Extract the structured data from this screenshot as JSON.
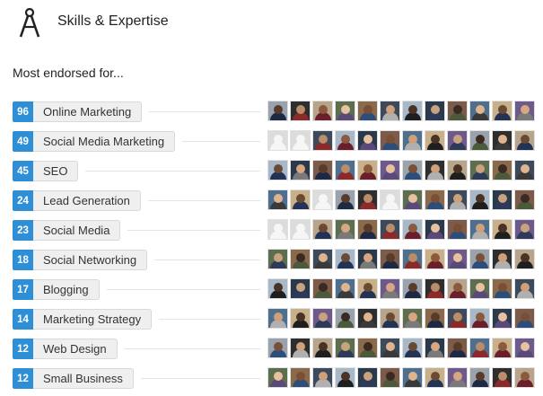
{
  "header": {
    "title": "Skills & Expertise",
    "icon": "compass-icon"
  },
  "subhead": "Most endorsed for...",
  "skills": [
    {
      "count": "96",
      "name": "Online Marketing"
    },
    {
      "count": "49",
      "name": "Social Media Marketing"
    },
    {
      "count": "45",
      "name": "SEO"
    },
    {
      "count": "24",
      "name": "Lead Generation"
    },
    {
      "count": "23",
      "name": "Social Media"
    },
    {
      "count": "18",
      "name": "Social Networking"
    },
    {
      "count": "17",
      "name": "Blogging"
    },
    {
      "count": "14",
      "name": "Marketing Strategy"
    },
    {
      "count": "12",
      "name": "Web Design"
    },
    {
      "count": "12",
      "name": "Small Business"
    }
  ],
  "colors": {
    "accent": "#2f8fd6",
    "pill": "#efefef"
  }
}
